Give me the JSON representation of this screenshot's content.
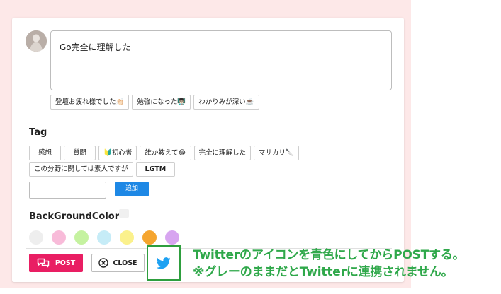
{
  "comment": {
    "text": "Go完全に理解した"
  },
  "quick_replies": [
    "登壇お疲れ様でした👏🏻",
    "勉強になった👨🏻‍🏫",
    "わかりみが深い☕️"
  ],
  "tag_section": {
    "title": "Tag",
    "tags_row1": [
      "感想",
      "質問",
      "🔰初心者",
      "誰か教えて😂",
      "完全に理解した",
      "マサカリ🔪"
    ],
    "tags_row2": [
      "この分野に関しては素人ですが",
      "LGTM"
    ],
    "input_value": "",
    "add_label": "追加"
  },
  "background_section": {
    "title": "BackGroundColor",
    "swatches": [
      "#eeeeee",
      "#f8bbd9",
      "#c5f2a0",
      "#c6ecf7",
      "#fbf18c",
      "#f5a52f",
      "#d7a5f0"
    ]
  },
  "actions": {
    "post_label": "POST",
    "close_label": "CLOSE",
    "twitter_color": "#1da1f2"
  },
  "annotation": {
    "line1": "Twitterのアイコンを青色にしてからPOSTする。",
    "line2": "※グレーのままだとTwitterに連携されません。"
  },
  "colors": {
    "frame": "#fde8e8",
    "post": "#e91e63",
    "add": "#1e88e5",
    "highlight": "#2e9e3e"
  }
}
